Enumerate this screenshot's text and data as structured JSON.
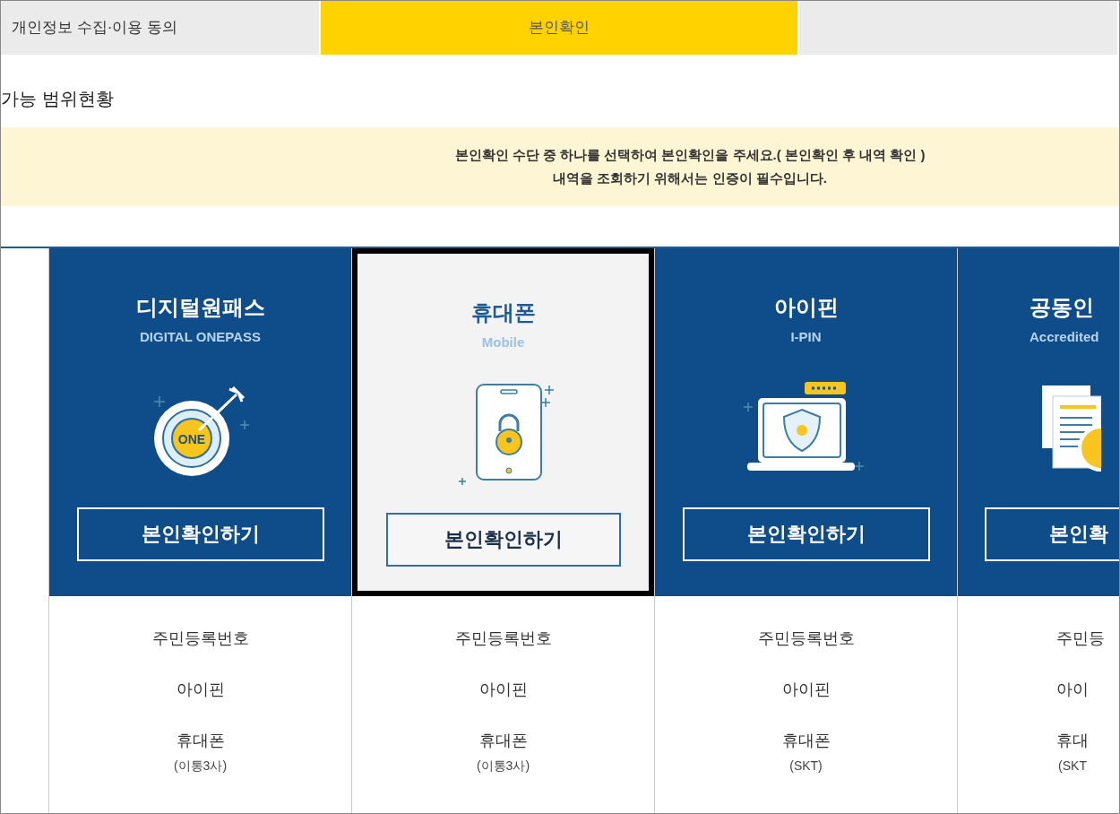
{
  "steps": [
    {
      "label": "개인정보 수집·이용 동의",
      "selected": false
    },
    {
      "label": "본인확인",
      "selected": true
    },
    {
      "selected": false
    }
  ],
  "heading": "가능 범위현황",
  "notice": [
    "본인확인 수단 중 하나를 선택하여 본인확인을 주세요.( 본인확인 후 내역 확인 )",
    "내역을 조회하기 위해서는 인증이 필수입니다."
  ],
  "methods": [
    {
      "title": "디지털원패스",
      "subtitle": "DIGITAL ONEPASS",
      "kind": "target",
      "icon_text": "ONE",
      "button": "본인확인하기",
      "selected": false,
      "items": [
        {
          "text": "주민등록번호"
        },
        {
          "text": "아이핀"
        },
        {
          "text": "휴대폰",
          "note": "(이통3사)"
        }
      ]
    },
    {
      "title": "휴대폰",
      "subtitle": "Mobile",
      "kind": "phone",
      "button": "본인확인하기",
      "selected": true,
      "items": [
        {
          "text": "주민등록번호"
        },
        {
          "text": "아이핀"
        },
        {
          "text": "휴대폰",
          "note": "(이통3사)"
        }
      ]
    },
    {
      "title": "아이핀",
      "subtitle": "I-PIN",
      "kind": "laptop",
      "button": "본인확인하기",
      "selected": false,
      "items": [
        {
          "text": "주민등록번호"
        },
        {
          "text": "아이핀"
        },
        {
          "text": "휴대폰",
          "note": "(SKT)"
        }
      ]
    },
    {
      "title": "공동인",
      "subtitle": "Accredited",
      "kind": "document",
      "button": "본인확",
      "selected": false,
      "partial": true,
      "items": [
        {
          "text": "주민등"
        },
        {
          "text": "아이"
        },
        {
          "text": "휴대",
          "note": "(SKT"
        }
      ]
    }
  ]
}
